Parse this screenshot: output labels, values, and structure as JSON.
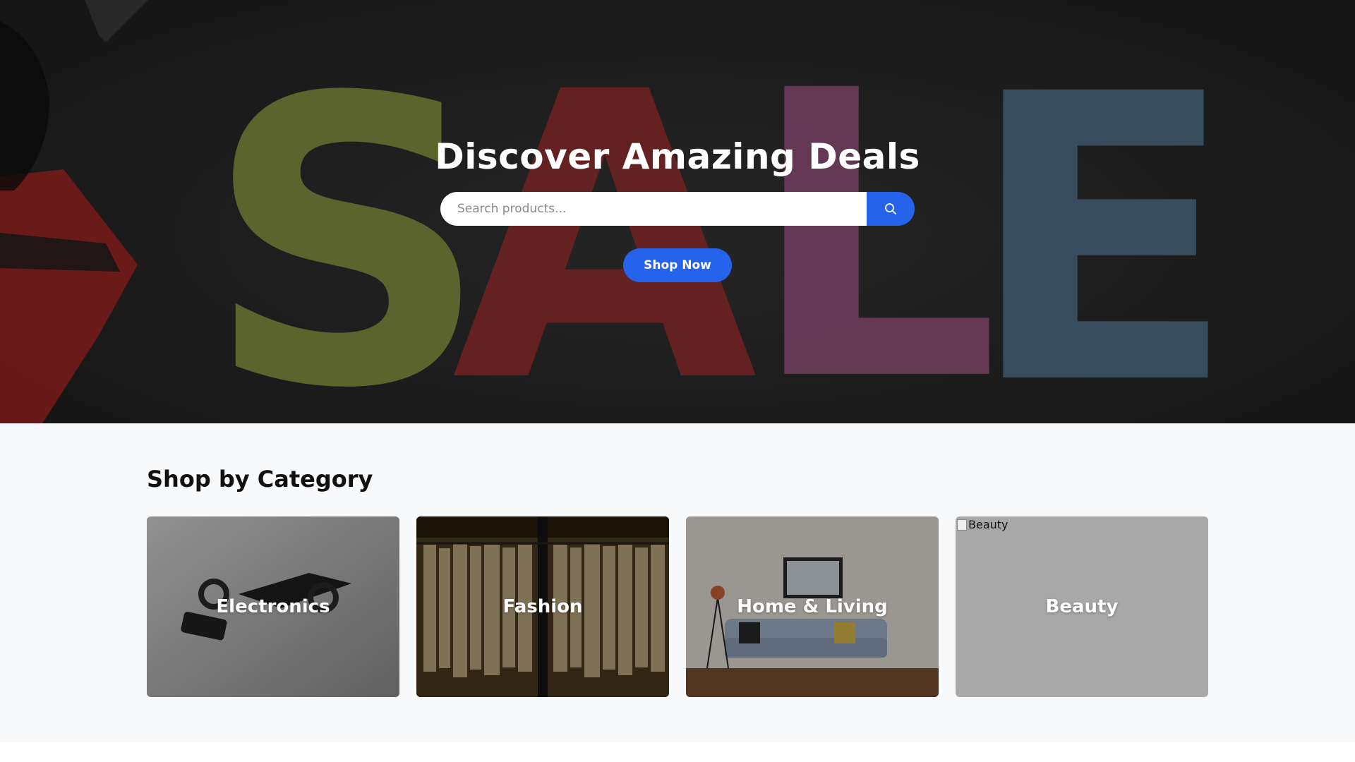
{
  "hero": {
    "title": "Discover Amazing Deals",
    "background_text": "SALE",
    "search": {
      "placeholder": "Search products...",
      "value": "",
      "button_icon": "search-icon"
    },
    "cta_label": "Shop Now"
  },
  "categories": {
    "title": "Shop by Category",
    "items": [
      {
        "label": "Electronics"
      },
      {
        "label": "Fashion"
      },
      {
        "label": "Home & Living"
      },
      {
        "label": "Beauty",
        "image_alt": "Beauty"
      }
    ]
  },
  "colors": {
    "accent": "#2563eb",
    "section_bg": "#f8f9fb",
    "sale_s": "#7d8a3a",
    "sale_a": "#8b2a2a",
    "sale_l": "#8a4a72",
    "sale_e": "#4a6a82"
  }
}
